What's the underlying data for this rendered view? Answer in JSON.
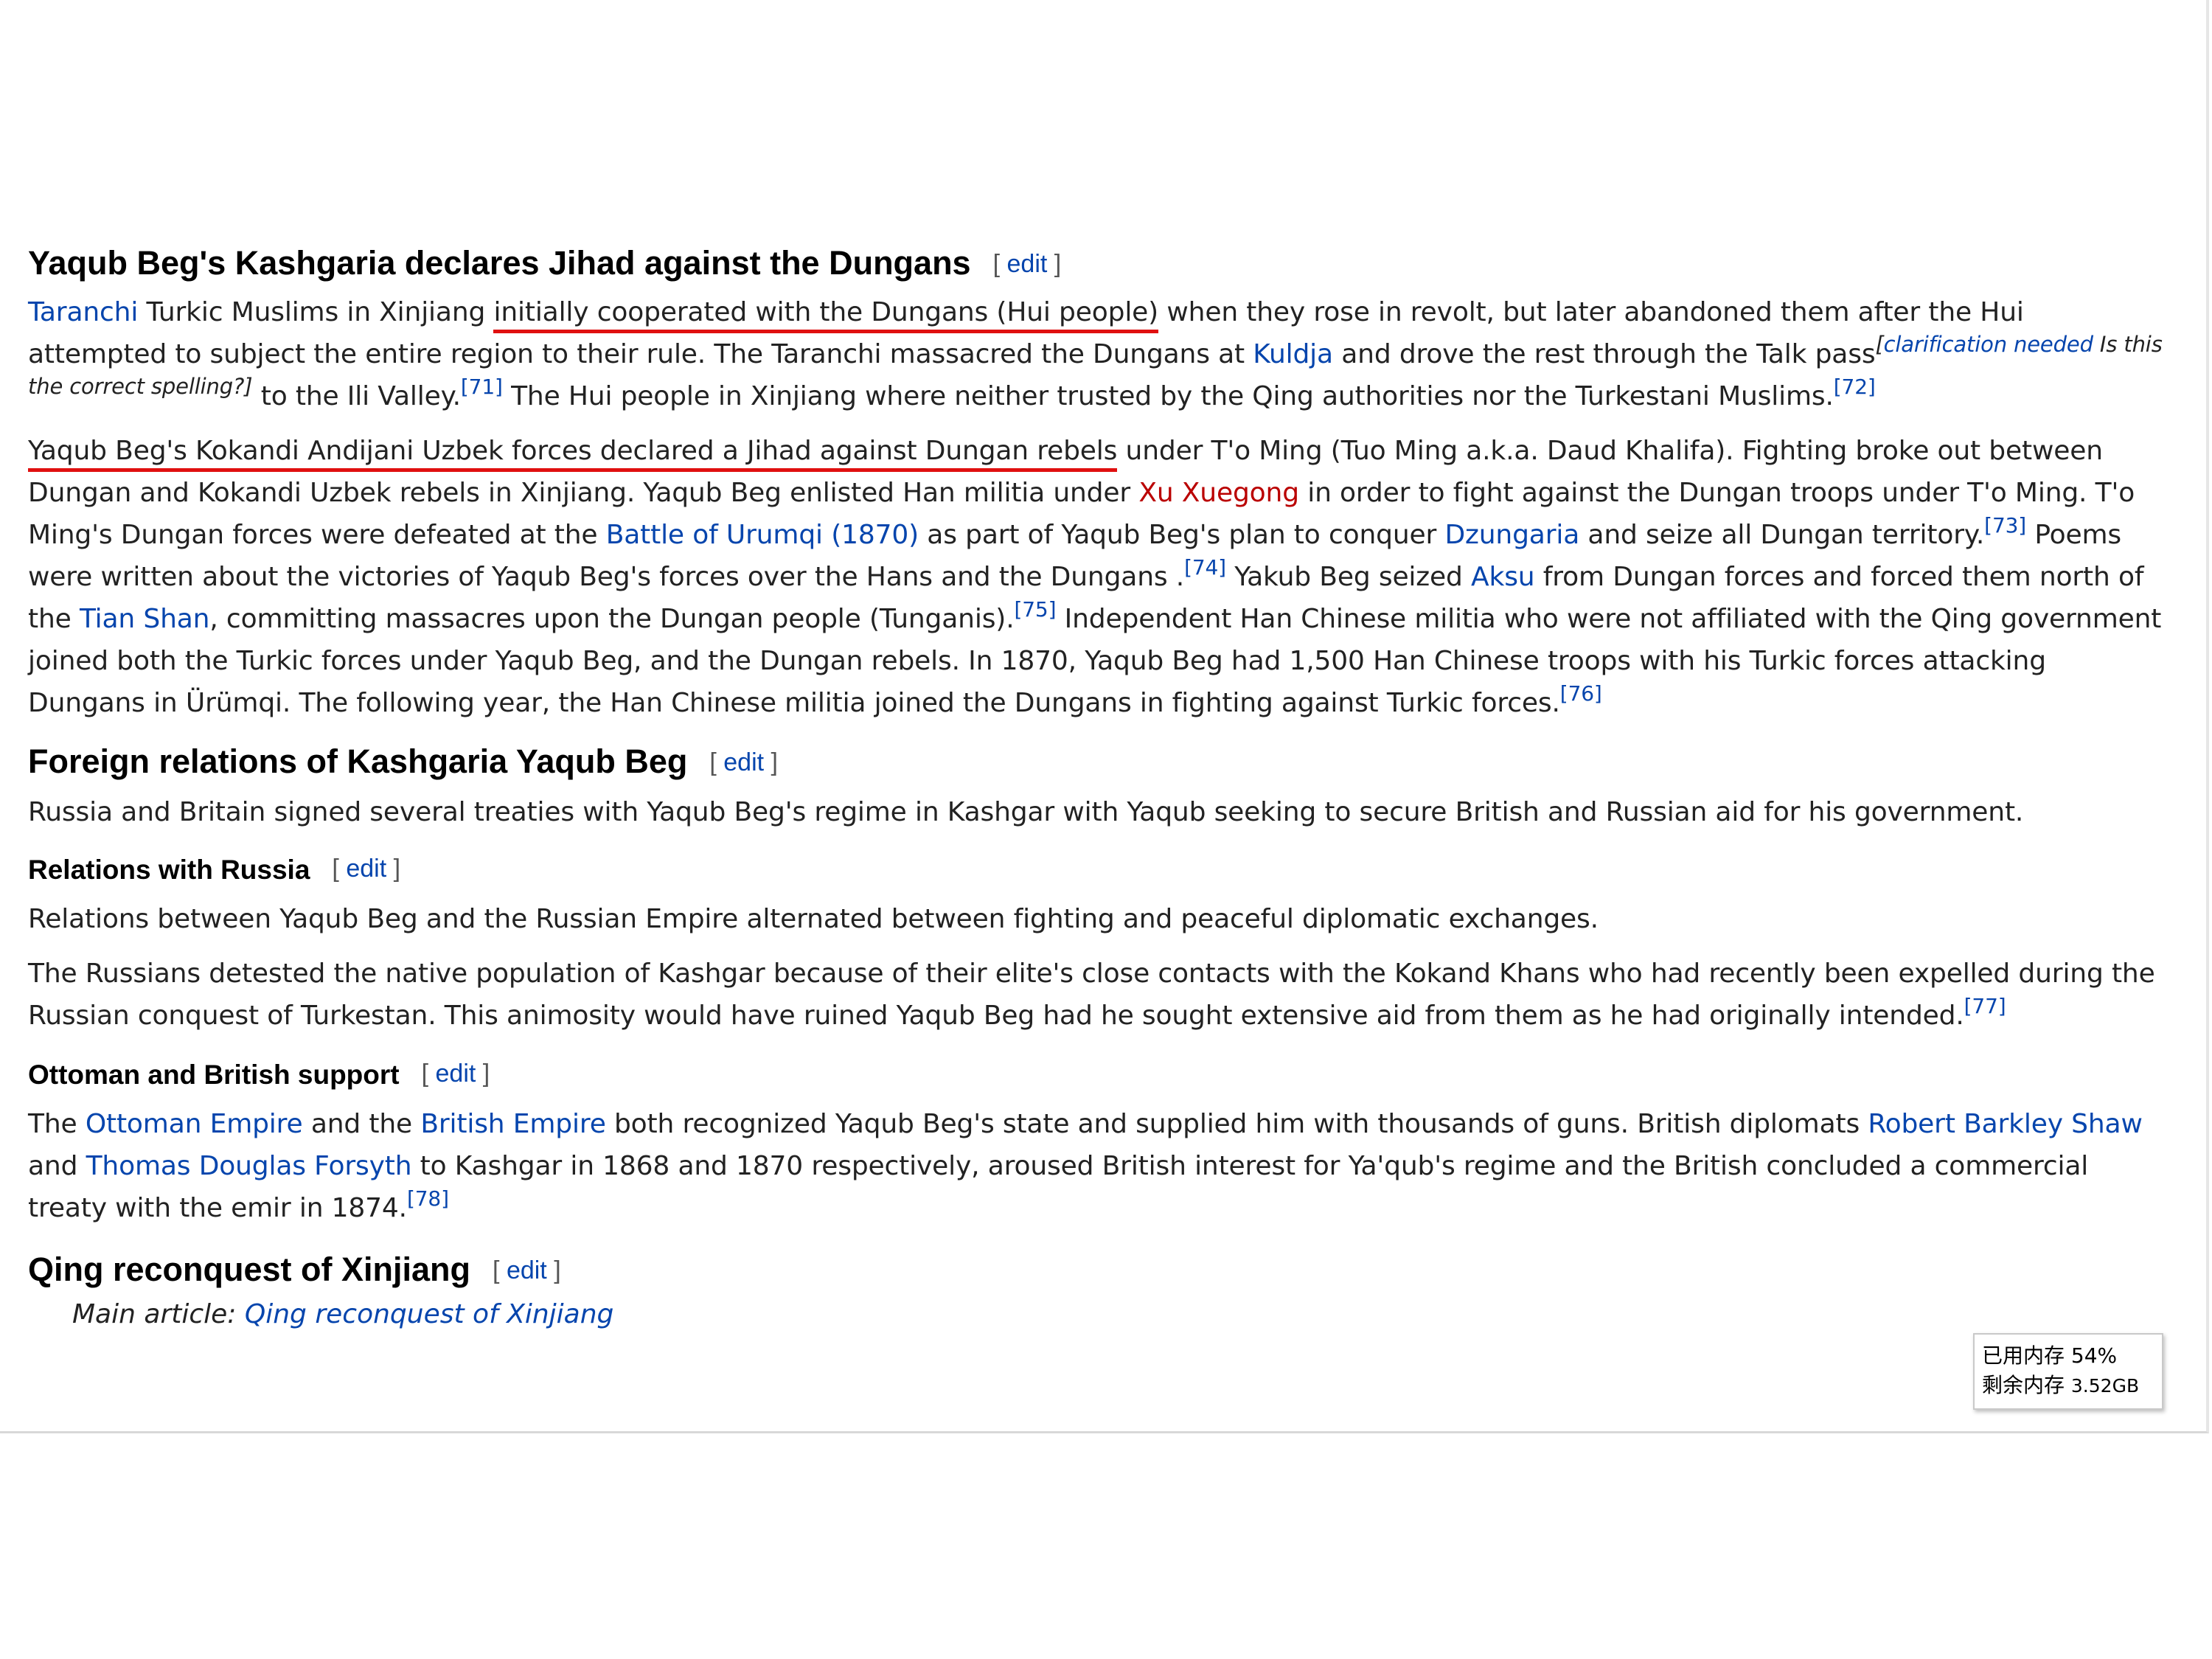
{
  "edit_link": "edit",
  "sections": {
    "jihad": {
      "title": "Yaqub Beg's Kashgaria declares Jihad against the Dungans",
      "p1": {
        "link_taranchi": "Taranchi",
        "t1": " Turkic Muslims in Xinjiang ",
        "underlined": "initially cooperated with the Dungans (Hui people)",
        "t2": " when they rose in revolt, but later abandoned them after the Hui attempted to subject the entire region to their rule. The Taranchi massacred the Dungans at ",
        "link_kuldja": "Kuldja",
        "t3": " and drove the rest through the Talk pass",
        "tmpl_open": "[",
        "tmpl_link": "clarification needed",
        "tmpl_text": " Is this the correct spelling?",
        "tmpl_close": "]",
        "t4": " to the Ili Valley.",
        "ref1": "[71]",
        "t5": " The Hui people in Xinjiang where neither trusted by the Qing authorities nor the Turkestani Muslims.",
        "ref2": "[72]"
      },
      "p2": {
        "underlined": "Yaqub Beg's Kokandi Andijani Uzbek forces declared a Jihad against Dungan rebels",
        "t1": " under T'o Ming (Tuo Ming a.k.a. Daud Khalifa). Fighting broke out between Dungan and Kokandi Uzbek rebels in Xinjiang. Yaqub Beg enlisted Han militia under ",
        "link_xu": "Xu Xuegong",
        "t2": " in order to fight against the Dungan troops under T'o Ming. T'o Ming's Dungan forces were defeated at the ",
        "link_battle": "Battle of Urumqi (1870)",
        "t3": " as part of Yaqub Beg's plan to conquer ",
        "link_dzungaria": "Dzungaria",
        "t4": " and seize all Dungan territory.",
        "ref1": "[73]",
        "t5": " Poems were written about the victories of Yaqub Beg's forces over the Hans and the Dungans .",
        "ref2": "[74]",
        "t6": " Yakub Beg seized ",
        "link_aksu": "Aksu",
        "t7": " from Dungan forces and forced them north of the ",
        "link_tianshan": "Tian Shan",
        "t8": ", committing massacres upon the Dungan people (Tunganis).",
        "ref3": "[75]",
        "t9": " Independent Han Chinese militia who were not affiliated with the Qing government joined both the Turkic forces under Yaqub Beg, and the Dungan rebels. In 1870, Yaqub Beg had 1,500 Han Chinese troops with his Turkic forces attacking Dungans in Ürümqi. The following year, the Han Chinese militia joined the Dungans in fighting against Turkic forces.",
        "ref4": "[76]"
      }
    },
    "foreign": {
      "title": "Foreign relations of Kashgaria Yaqub Beg",
      "p1": "Russia and Britain signed several treaties with Yaqub Beg's regime in Kashgar with Yaqub seeking to secure British and Russian aid for his government."
    },
    "russia": {
      "title": "Relations with Russia",
      "p1": "Relations between Yaqub Beg and the Russian Empire alternated between fighting and peaceful diplomatic exchanges.",
      "p2": "The Russians detested the native population of Kashgar because of their elite's close contacts with the Kokand Khans who had recently been expelled during the Russian conquest of Turkestan. This animosity would have ruined Yaqub Beg had he sought extensive aid from them as he had originally intended.",
      "p2_ref": "[77]"
    },
    "ottoman": {
      "title": "Ottoman and British support",
      "t1": "The ",
      "link_ottoman": "Ottoman Empire",
      "t2": " and the ",
      "link_british": "British Empire",
      "t3": " both recognized Yaqub Beg's state and supplied him with thousands of guns. British diplomats ",
      "link_shaw": "Robert Barkley Shaw",
      "t4": " and ",
      "link_forsyth": "Thomas Douglas Forsyth",
      "t5": " to Kashgar in 1868 and 1870 respectively, aroused British interest for Ya'qub's regime and the British concluded a commercial treaty with the emir in 1874.",
      "ref": "[78]"
    },
    "qing": {
      "title": "Qing reconquest of Xinjiang",
      "hatnote_label": "Main article: ",
      "hatnote_link": "Qing reconquest of Xinjiang"
    }
  },
  "memory_widget": {
    "used_label": "已用内存 54%",
    "free_label": "剩余内存 ",
    "free_value": "3.52GB"
  }
}
